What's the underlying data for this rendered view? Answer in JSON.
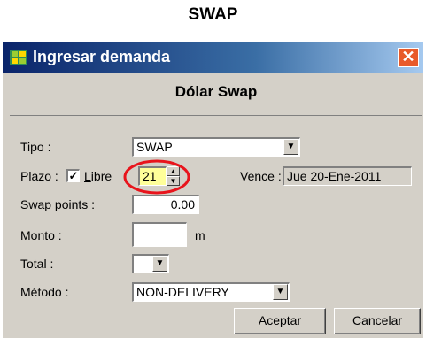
{
  "page": {
    "title": "SWAP"
  },
  "window": {
    "title": "Ingresar demanda",
    "close_symbol": "✕",
    "header": "Dólar Swap"
  },
  "form": {
    "tipo": {
      "label": "Tipo :",
      "value": "SWAP"
    },
    "plazo": {
      "label": "Plazo :",
      "checkbox_checked": true,
      "checkbox_label_underlined": "L",
      "checkbox_label_rest": "ibre",
      "value": "21"
    },
    "vence": {
      "label": "Vence :",
      "value": "Jue  20-Ene-2011"
    },
    "swap_points": {
      "label": "Swap points :",
      "value": "0.00"
    },
    "monto": {
      "label": "Monto :",
      "value": "",
      "unit": "m"
    },
    "total": {
      "label": "Total :",
      "value": ""
    },
    "metodo": {
      "label": "Método :",
      "value": "NON-DELIVERY"
    }
  },
  "buttons": {
    "aceptar": {
      "underlined": "A",
      "rest": "ceptar"
    },
    "cancelar": {
      "underlined": "C",
      "rest": "ancelar"
    }
  },
  "colors": {
    "titlebar_start": "#0a246a",
    "titlebar_end": "#a6caf0",
    "highlight_field": "#ffff99",
    "annotation_circle": "#e8141c"
  },
  "icons": {
    "window_icon": "app-grid-icon",
    "close": "close-icon",
    "dropdown": "chevron-down-icon",
    "spinner": "spin-arrows-icon"
  }
}
